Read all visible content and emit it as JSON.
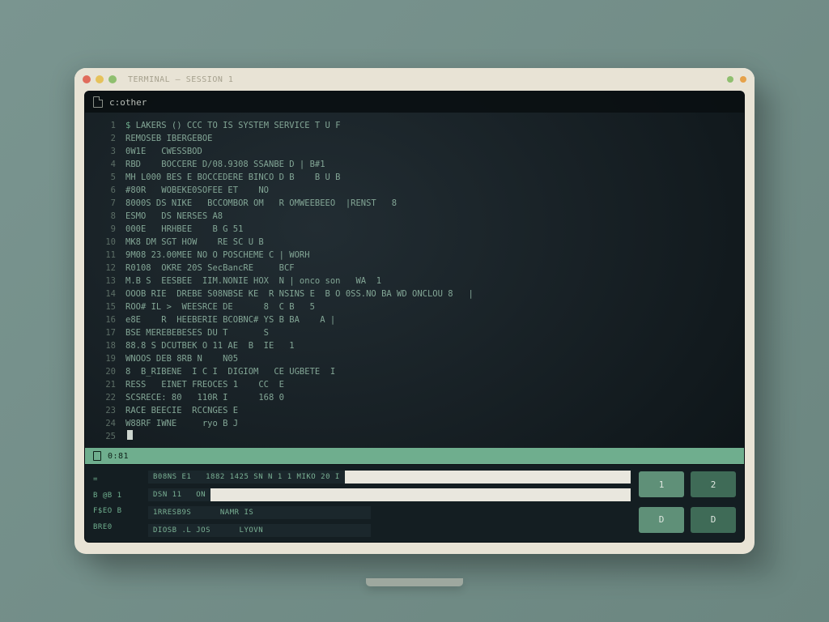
{
  "chrome": {
    "title": "TERMINAL — SESSION 1"
  },
  "tab": {
    "label": "c:other"
  },
  "lines": [
    {
      "n": "1",
      "prompt": "$",
      "text": "LAKERS () CCC TO IS SYSTEM SERVICE T U F"
    },
    {
      "n": "2",
      "prompt": "",
      "text": "REMOSEB IBERGEBOE"
    },
    {
      "n": "3",
      "prompt": "",
      "text": "0W1E   CWESSBOD"
    },
    {
      "n": "4",
      "prompt": "",
      "text": "RBD    BOCCERE D/08.9308 SSANBE D | B#1"
    },
    {
      "n": "5",
      "prompt": "",
      "text": "MH L000 BES E BOCCEDERE BINCO D B    B U B"
    },
    {
      "n": "6",
      "prompt": "",
      "text": "#80R   WOBEKE0SOFEE ET    NO"
    },
    {
      "n": "7",
      "prompt": "",
      "text": "8000S DS NIKE   BCCOMBOR OM   R OMWEEBEEO  |RENST   8"
    },
    {
      "n": "8",
      "prompt": "",
      "text": "ESMO   DS NERSES A8"
    },
    {
      "n": "9",
      "prompt": "",
      "text": "000E   HRHBEE    B G 51"
    },
    {
      "n": "10",
      "prompt": "",
      "text": "MK8 DM SGT HOW    RE SC U B"
    },
    {
      "n": "11",
      "prompt": "",
      "text": "9M08 23.00MEE NO O POSCHEME C | WORH"
    },
    {
      "n": "12",
      "prompt": "",
      "text": "R0108  OKRE 20S SecBancRE     BCF"
    },
    {
      "n": "13",
      "prompt": "",
      "text": "M.B S  EESBEE  IIM.NONIE HOX  N | onco son   WA  1"
    },
    {
      "n": "14",
      "prompt": "",
      "text": "OOOB RIE  DREBE S08NBSE KE  R NSINS E  B O 0SS.NO BA WD ONCLOU 8   |"
    },
    {
      "n": "15",
      "prompt": "",
      "text": "ROO# IL >  WEESRCE DE      8  C B   5"
    },
    {
      "n": "16",
      "prompt": "",
      "text": "e8E    R  HEEBERIE BCOBNC# YS B BA    A |"
    },
    {
      "n": "17",
      "prompt": "",
      "text": "BSE MEREBEBESES DU T       S"
    },
    {
      "n": "18",
      "prompt": "",
      "text": "88.8 S DCUTBEK O 11 AE  B  IE   1"
    },
    {
      "n": "19",
      "prompt": "",
      "text": "WNOOS DEB 8RB N    N05"
    },
    {
      "n": "20",
      "prompt": "",
      "text": "8  B_RIBENE  I C I  DIGIOM   CE UGBETE  I"
    },
    {
      "n": "21",
      "prompt": "",
      "text": "RESS   EINET FREOCES 1    CC  E"
    },
    {
      "n": "22",
      "prompt": "",
      "text": "SCSRECE: 80   110R I      168 0"
    },
    {
      "n": "23",
      "prompt": "",
      "text": "RACE BEECIE  RCCNGES E"
    },
    {
      "n": "24",
      "prompt": "",
      "text": "W88RF IWNE     ryo B J"
    }
  ],
  "cursor_line": {
    "n": "25",
    "prompt": ""
  },
  "status": {
    "label": "0:81"
  },
  "bottom": {
    "left_labels": [
      "=",
      "B @B 1",
      "F$EO B",
      "BRE0"
    ],
    "row1": {
      "dark": "B08NS E1   1882 1425 SN N 1 1 MIKO 20 I",
      "has_white": true
    },
    "row2": {
      "dark": "DSN 11   ON",
      "has_white": true
    },
    "row3": {
      "dark": "1RRESB9S      NAMR IS",
      "has_white": false
    },
    "row4": {
      "dark": "DIOSB .L JOS      LYOVN",
      "has_white": false
    },
    "buttons": [
      "1",
      "2",
      "D",
      "D"
    ]
  }
}
